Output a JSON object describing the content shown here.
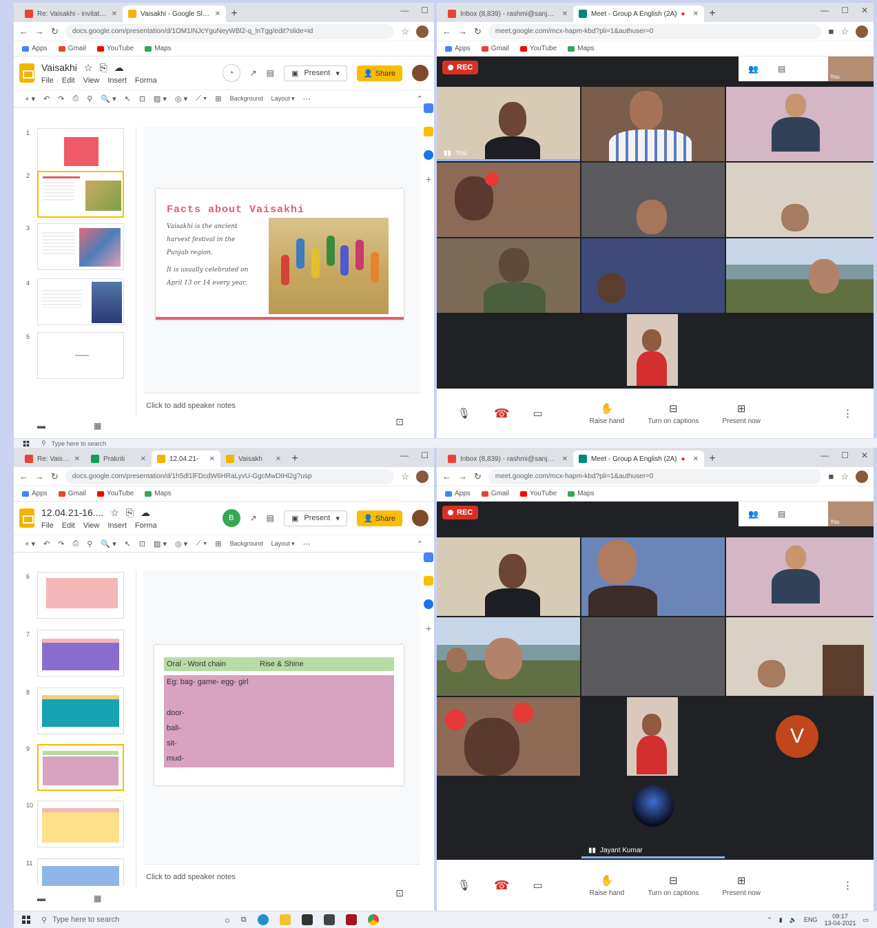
{
  "top_slides": {
    "tabs": [
      {
        "title": "Re: Vaisakhi - invitation to activ"
      },
      {
        "title": "Vaisakhi - Google Slides"
      }
    ],
    "url": "docs.google.com/presentation/d/1OM1INJcYguNeyWBl2-q_lnTgg/edit?slide=id",
    "bookmarks": [
      "Apps",
      "Gmail",
      "YouTube",
      "Maps"
    ],
    "doc_title": "Vaisakhi",
    "menu": [
      "File",
      "Edit",
      "View",
      "Insert",
      "Forma"
    ],
    "present_label": "Present",
    "share_label": "Share",
    "toolbar_background": "Background",
    "toolbar_layout": "Layout",
    "thumb_numbers": [
      "1",
      "2",
      "3",
      "4",
      "5"
    ],
    "slide": {
      "title": "Facts about Vaisakhi",
      "lines": [
        "Vaisakhi is the ancient",
        "harvest festival in the",
        "Punjab region.",
        "It is usually celebrated on",
        "April 13 or 14 every year."
      ]
    },
    "notes": "Click to add speaker notes"
  },
  "top_meet": {
    "tabs": [
      {
        "title": "Inbox (8,839) - rashmi@sanjay..."
      },
      {
        "title": "Meet - Group A English (2A)"
      }
    ],
    "url": "meet.google.com/mcx-hapm-kbd?pli=1&authuser=0",
    "bookmarks": [
      "Apps",
      "Gmail",
      "YouTube",
      "Maps"
    ],
    "rec_label": "REC",
    "self_label": "You",
    "you_tile_label": "You",
    "controls": {
      "raise_hand": "Raise hand",
      "captions": "Turn on captions",
      "present": "Present now"
    }
  },
  "bottom_slides": {
    "tabs": [
      {
        "title": "Re: Vaisakh"
      },
      {
        "title": "Prakriti"
      },
      {
        "title": "12.04.21-"
      },
      {
        "title": "Vaisakh"
      }
    ],
    "url": "docs.google.com/presentation/d/1h5dl1lFDcdW6HRaLyvU-GgcMwDtHl2g?usp",
    "bookmarks": [
      "Apps",
      "Gmail",
      "YouTube",
      "Maps"
    ],
    "doc_title": "12.04.21-16....",
    "menu": [
      "File",
      "Edit",
      "View",
      "Insert",
      "Forma"
    ],
    "user_initial": "B",
    "present_label": "Present",
    "share_label": "Share",
    "toolbar_background": "Background",
    "toolbar_layout": "Layout",
    "thumb_numbers": [
      "6",
      "7",
      "8",
      "9",
      "10",
      "11"
    ],
    "slide": {
      "header": [
        "Oral - Word chain",
        "Rise & Shine"
      ],
      "example": "Eg: bag- game- egg- girl",
      "words": [
        "door-",
        "ball-",
        "sit-",
        "mud-"
      ]
    },
    "notes": "Click to add speaker notes"
  },
  "bottom_meet": {
    "tabs": [
      {
        "title": "Inbox (8,839) - rashmi@sanjay..."
      },
      {
        "title": "Meet - Group A English (2A)"
      }
    ],
    "url": "meet.google.com/mcx-hapm-kbd?pli=1&authuser=0",
    "bookmarks": [
      "Apps",
      "Gmail",
      "YouTube",
      "Maps"
    ],
    "rec_label": "REC",
    "self_label": "You",
    "avatar_initial": "V",
    "participant_name": "Jayant Kumar",
    "controls": {
      "raise_hand": "Raise hand",
      "captions": "Turn on captions",
      "present": "Present now"
    }
  },
  "taskbar": {
    "search_placeholder": "Type here to search",
    "lang": "ENG",
    "time": "09:17",
    "date": "13-04-2021"
  },
  "colors": {
    "accent_red": "#d93025",
    "share_yellow": "#fbbc04",
    "slide_title_pink": "#e35e6e",
    "table_green": "#b6dca3",
    "table_pink": "#d8a2c0",
    "meet_bg": "#202124"
  }
}
